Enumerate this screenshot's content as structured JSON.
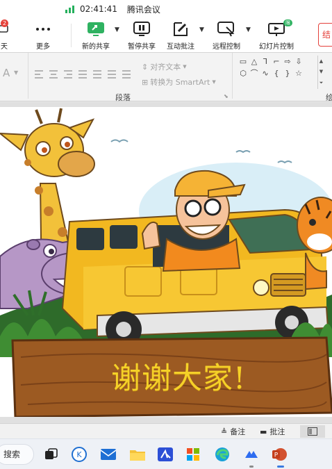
{
  "meeting": {
    "clock": "02:41:41",
    "app_title": "腾讯会议",
    "chat_label": "天",
    "chat_badge": "2",
    "more_label": "更多",
    "new_share_label": "新的共享",
    "pause_share_label": "暂停共享",
    "annotate_label": "互动批注",
    "remote_label": "远程控制",
    "slideshow_label": "幻灯片控制",
    "slideshow_badge": "限免",
    "end_label": "结"
  },
  "ribbon": {
    "align_text_label": "对齐文本",
    "smartart_label": "转换为 SmartArt",
    "paragraph_group": "段落",
    "right_group": "绘"
  },
  "slide": {
    "thanks_text": "谢谢大家!"
  },
  "ppt_status": {
    "notes_label": "备注",
    "comments_label": "批注"
  },
  "taskbar": {
    "search_label": "搜索"
  },
  "colors": {
    "accent_green": "#25b05d",
    "danger_red": "#e4403a",
    "bus_yellow": "#f2b820",
    "sign_wood": "#9c5a22",
    "thanks_yellow": "#f5d128"
  }
}
